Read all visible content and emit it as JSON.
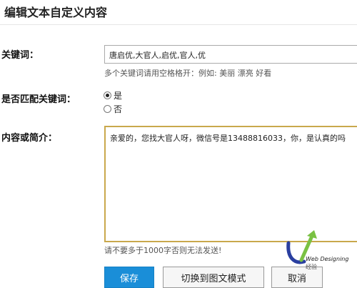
{
  "header": {
    "title": "编辑文本自定义内容"
  },
  "keywords": {
    "label": "关键词：",
    "value": "唐启优,大官人,启优,官人,优",
    "hint": "多个关键词请用空格格开：例如: 美丽 漂亮 好看"
  },
  "match": {
    "label": "是否匹配关键词：",
    "options": [
      {
        "label": "是",
        "checked": true
      },
      {
        "label": "否",
        "checked": false
      }
    ]
  },
  "content": {
    "label": "内容或简介：",
    "value": "亲爱的，您找大官人呀，微信号是13488816033，你，是认真的吗",
    "hint": "请不要多于1000字否则无法发送!"
  },
  "actions": {
    "save": "保存",
    "switch": "切换到图文模式",
    "cancel": "取消"
  },
  "watermark": {
    "line1": "Web Designing",
    "line2": "经验"
  },
  "colors": {
    "primary": "#1a8ed8",
    "textarea_border": "#c9a84c"
  }
}
